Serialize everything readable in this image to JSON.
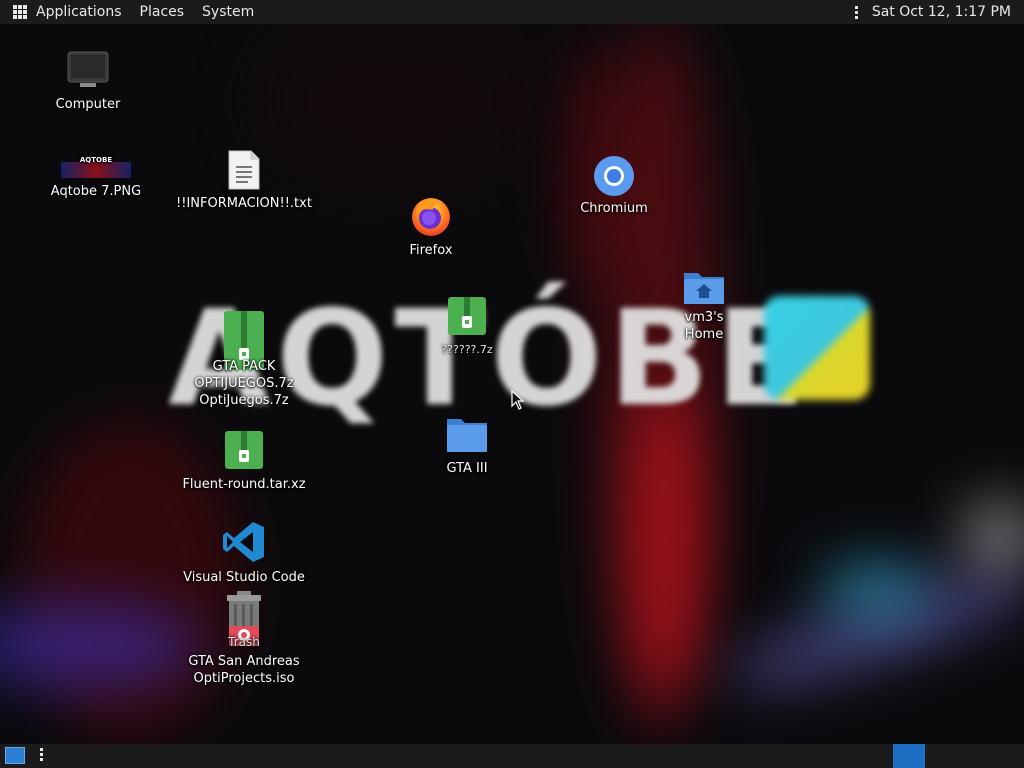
{
  "top_panel": {
    "menu": [
      "Applications",
      "Places",
      "System"
    ],
    "clock": "Sat Oct 12,  1:17 PM"
  },
  "wallpaper": {
    "text": "AQTÓBE"
  },
  "desktop_icons": {
    "computer": "Computer",
    "aqtobe_png": "Aqtobe 7.PNG",
    "aqtobe_thumb_text": "AQTOBE",
    "informacion": "!!INFORMACION!!.txt",
    "firefox": "Firefox",
    "chromium": "Chromium",
    "home": "vm3's Home",
    "archive_mid": "??????.7z",
    "gta_pack_line1": "GTA  PACK",
    "gta_pack_line2": "OPTIJUEGOS.7z",
    "gta_pack_line3": "OptiJuegos.7z",
    "gta3": "GTA III",
    "fluent": "Fluent-round.tar.xz",
    "vscode": "Visual Studio Code",
    "trash": "Trash",
    "gta_sa_line1": "GTA San Andreas",
    "gta_sa_line2": "OptiProjects.iso"
  },
  "colors": {
    "panel_bg": "#1b1b1b",
    "archive_green": "#4caf50",
    "folder_blue": "#4a8fdc",
    "vscode_blue": "#1f8ad2",
    "workspace_active": "#1e6fc4"
  }
}
